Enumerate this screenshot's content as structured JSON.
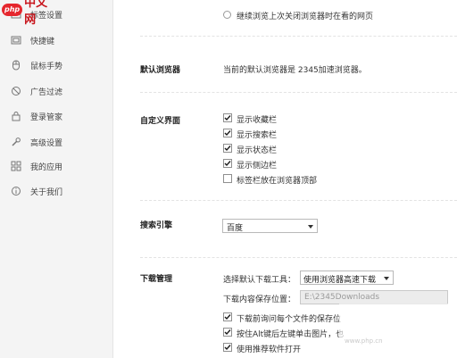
{
  "logo": {
    "badge": "php",
    "text": "中文网"
  },
  "sidebar": {
    "items": [
      {
        "label": "标签设置",
        "icon": "tab-icon"
      },
      {
        "label": "快捷键",
        "icon": "keyboard-icon"
      },
      {
        "label": "鼠标手势",
        "icon": "mouse-icon"
      },
      {
        "label": "广告过滤",
        "icon": "block-icon"
      },
      {
        "label": "登录管家",
        "icon": "lock-icon"
      },
      {
        "label": "高级设置",
        "icon": "wrench-icon"
      },
      {
        "label": "我的应用",
        "icon": "apps-icon"
      },
      {
        "label": "关于我们",
        "icon": "info-icon"
      }
    ]
  },
  "startup": {
    "option_label": "继续浏览上次关闭浏览器时在看的网页"
  },
  "default_browser": {
    "section_label": "默认浏览器",
    "message": "当前的默认浏览器是 2345加速浏览器。"
  },
  "custom_ui": {
    "section_label": "自定义界面",
    "options": [
      {
        "label": "显示收藏栏",
        "checked": true
      },
      {
        "label": "显示搜索栏",
        "checked": true
      },
      {
        "label": "显示状态栏",
        "checked": true
      },
      {
        "label": "显示侧边栏",
        "checked": true
      },
      {
        "label": "标签栏放在浏览器顶部",
        "checked": false
      }
    ]
  },
  "search_engine": {
    "section_label": "搜索引擎",
    "selected": "百度"
  },
  "download": {
    "section_label": "下载管理",
    "tool_label": "选择默认下载工具：",
    "tool_selected": "使用浏览器高速下载",
    "path_label": "下载内容保存位置：",
    "path_value": "E:\\2345Downloads",
    "options": [
      {
        "label": "下载前询问每个文件的保存位",
        "checked": true
      },
      {
        "label": "按住Alt键后左键单击图片，也",
        "checked": true
      },
      {
        "label": "使用推荐软件打开",
        "checked": true
      }
    ]
  },
  "watermark": {
    "text": "www.php.cn"
  },
  "colors": {
    "accent": "#e5262d",
    "sidebar_bg": "#f4f4f4"
  }
}
